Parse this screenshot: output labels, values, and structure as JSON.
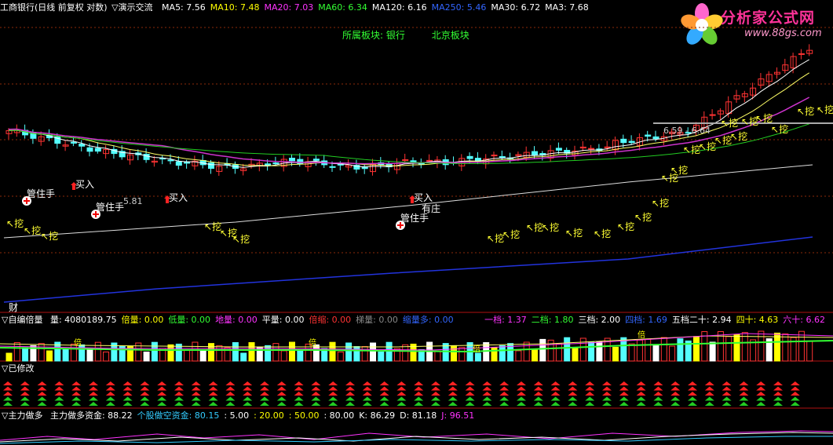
{
  "header": {
    "title": "工商银行(日线 前复权 对数)",
    "indicator": "▽演示交流",
    "ma": [
      {
        "label": "MA5: 7.56",
        "color": "#ffffff"
      },
      {
        "label": "MA10: 7.48",
        "color": "#ffff00"
      },
      {
        "label": "MA20: 7.03",
        "color": "#ff33ff"
      },
      {
        "label": "MA60: 6.34",
        "color": "#33ff33"
      },
      {
        "label": "MA120: 6.16",
        "color": "#ffffff"
      },
      {
        "label": "MA250: 5.46",
        "color": "#3366ff"
      },
      {
        "label": "MA30: 6.72",
        "color": "#ffffff"
      },
      {
        "label": "MA3: 7.68",
        "color": "#ffffff"
      }
    ]
  },
  "sector": {
    "label": "所属板块: 银行",
    "region": "北京板块"
  },
  "watermark": {
    "name": "分析家公式网",
    "url": "www.88gs.com"
  },
  "price_labels": {
    "range": "6.59 - 6.64",
    "low": "5.81",
    "bottom_mark": "财"
  },
  "annotations": {
    "buy": "买入",
    "hold": "管住手",
    "dealer": "有庄",
    "dig": "挖"
  },
  "volume_panel": {
    "name": "▽自编倍量",
    "items": [
      {
        "label": "量: 4080189.75",
        "color": "#ffffff"
      },
      {
        "label": "倍量: 0.00",
        "color": "#ffff00"
      },
      {
        "label": "低量: 0.00",
        "color": "#33ff33"
      },
      {
        "label": "地量: 0.00",
        "color": "#ff33ff"
      },
      {
        "label": "平量: 0.00",
        "color": "#ffffff"
      },
      {
        "label": "倍缩: 0.00",
        "color": "#ff3333"
      },
      {
        "label": "梯量: 0.00",
        "color": "#888888"
      },
      {
        "label": "缩量多: 0.00",
        "color": "#3366ff"
      }
    ],
    "right_items": [
      {
        "label": "一档: 1.37",
        "color": "#ff33ff"
      },
      {
        "label": "二档: 1.80",
        "color": "#33ff33"
      },
      {
        "label": "三档: 2.00",
        "color": "#ffffff"
      },
      {
        "label": "四档: 1.69",
        "color": "#3366ff"
      },
      {
        "label": "五档二十: 2.94",
        "color": "#ffffff"
      },
      {
        "label": "四十: 4.63",
        "color": "#ffff00"
      },
      {
        "label": "六十: 6.62",
        "color": "#ff33ff"
      }
    ],
    "marker": "倍"
  },
  "modified_panel": {
    "name": "▽已修改"
  },
  "main_force_panel": {
    "name": "▽主力做多",
    "items": [
      {
        "label": "主力做多资金: 88.22",
        "color": "#ffffff"
      },
      {
        "label": "个股做空资金: 80.15",
        "color": "#33ccff"
      },
      {
        "label": ": 5.00",
        "color": "#ffffff"
      },
      {
        "label": ": 20.00",
        "color": "#ffff00"
      },
      {
        "label": ": 50.00",
        "color": "#ffff00"
      },
      {
        "label": ": 80.00",
        "color": "#ffffff"
      },
      {
        "label": "K: 86.29",
        "color": "#ffffff"
      },
      {
        "label": "D: 81.18",
        "color": "#ffffff"
      },
      {
        "label": "J: 96.51",
        "color": "#ff33ff"
      }
    ]
  },
  "colors": {
    "up": "#ff3333",
    "down": "#54ffff",
    "grid": "#8b2a0a",
    "separator": "#b01010",
    "ma5": "#ffffff",
    "ma10": "#ffff66",
    "ma20": "#cc33cc",
    "ma60": "#22cc22",
    "ma250": "#2233dd"
  }
}
